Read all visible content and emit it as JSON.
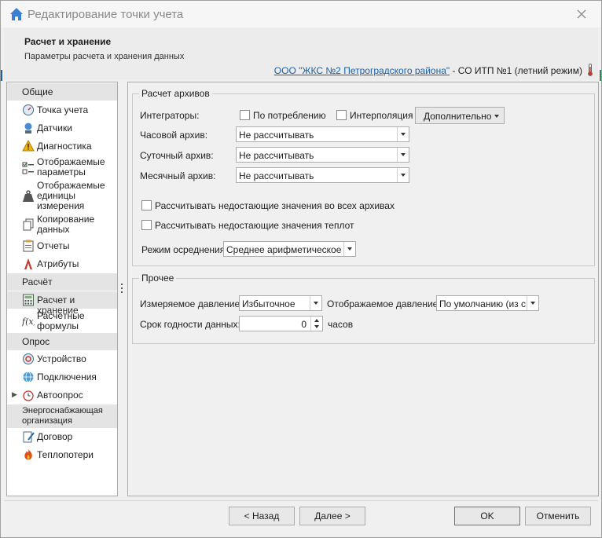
{
  "window": {
    "title": "Редактирование точки учета",
    "close_icon": "close-icon",
    "app_icon": "home-icon"
  },
  "header": {
    "title": "Расчет и хранение",
    "subtitle": "Параметры расчета и хранения данных",
    "org_link": "ООО \"ЖКС №2 Петроградского района\"",
    "org_suffix": " - СО ИТП №1 (летний режим)",
    "org_icon": "thermometer-icon"
  },
  "sidebar": {
    "groups": [
      {
        "title": "Общие",
        "items": [
          {
            "label": "Точка учета",
            "icon": "meter-point-icon"
          },
          {
            "label": "Датчики",
            "icon": "sensor-icon"
          },
          {
            "label": "Диагностика",
            "icon": "warning-icon"
          },
          {
            "label": "Отображаемые параметры",
            "icon": "checklist-icon"
          },
          {
            "label": "Отображаемые единицы измерения",
            "icon": "weight-icon"
          },
          {
            "label": "Копирование данных",
            "icon": "copy-icon"
          },
          {
            "label": "Отчеты",
            "icon": "clipboard-icon"
          },
          {
            "label": "Атрибуты",
            "icon": "attributes-icon"
          }
        ]
      },
      {
        "title": "Расчёт",
        "items": [
          {
            "label": "Расчет и хранение",
            "icon": "calculator-icon"
          },
          {
            "label": "Расчётные формулы",
            "icon": "function-icon"
          }
        ]
      },
      {
        "title": "Опрос",
        "items": [
          {
            "label": "Устройство",
            "icon": "device-icon"
          },
          {
            "label": "Подключения",
            "icon": "globe-icon"
          },
          {
            "label": "Автоопрос",
            "icon": "alarm-clock-icon"
          }
        ]
      },
      {
        "title": "Энергоснабжающая организация",
        "items": [
          {
            "label": "Договор",
            "icon": "contract-icon"
          },
          {
            "label": "Теплопотери",
            "icon": "flame-icon"
          }
        ]
      }
    ]
  },
  "archives": {
    "title": "Расчет архивов",
    "integrators_label": "Интеграторы:",
    "by_consumption": "По потреблению",
    "interpolation": "Интерполяция",
    "extra_button": "Дополнительно",
    "hourly_label": "Часовой архив:",
    "hourly_value": "Не рассчитывать",
    "daily_label": "Суточный архив:",
    "daily_value": "Не рассчитывать",
    "monthly_label": "Месячный архив:",
    "monthly_value": "Не рассчитывать",
    "calc_missing_all": "Рассчитывать недостающие значения во всех архивах",
    "calc_missing_heatloss": "Рассчитывать недостающие значения теплот",
    "averaging_label": "Режим осреднения:",
    "averaging_value": "Среднее арифметическое"
  },
  "other": {
    "title": "Прочее",
    "pressure_label": "Измеряемое давление:",
    "pressure_value": "Избыточное",
    "display_pressure_label": "Отображаемое давление:",
    "display_pressure_value": "По умолчанию (из с...",
    "shelf_life_label": "Срок годности данных:",
    "shelf_life_value": "0",
    "shelf_life_unit": "часов"
  },
  "footer": {
    "back": "< Назад",
    "next": "Далее >",
    "ok": "OK",
    "cancel": "Отменить"
  }
}
